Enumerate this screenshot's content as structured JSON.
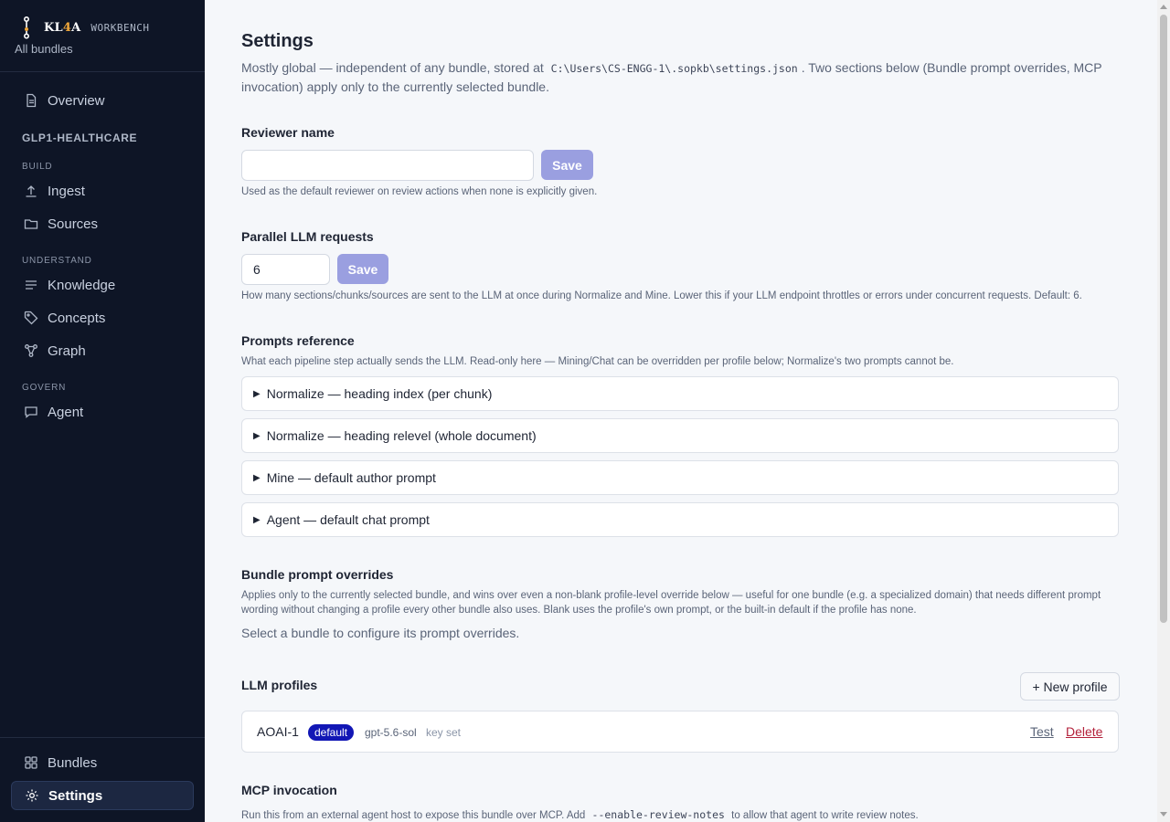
{
  "brand": {
    "name_prefix": "KL",
    "name_accent": "4",
    "name_suffix": "A",
    "subtitle": "WORKBENCH",
    "all_bundles": "All bundles"
  },
  "sidebar": {
    "overview": "Overview",
    "bundle_name": "GLP1-HEALTHCARE",
    "groups": {
      "build": "BUILD",
      "understand": "UNDERSTAND",
      "govern": "GOVERN"
    },
    "items": {
      "ingest": "Ingest",
      "sources": "Sources",
      "knowledge": "Knowledge",
      "concepts": "Concepts",
      "graph": "Graph",
      "agent": "Agent",
      "bundles": "Bundles",
      "settings": "Settings"
    },
    "active": "Settings"
  },
  "page": {
    "title": "Settings",
    "desc_before": "Mostly global — independent of any bundle, stored at",
    "desc_path": "C:\\Users\\CS-ENGG-1\\.sopkb\\settings.json",
    "desc_after": ". Two sections below (Bundle prompt overrides, MCP invocation) apply only to the currently selected bundle."
  },
  "reviewer": {
    "title": "Reviewer name",
    "value": "",
    "placeholder": "",
    "save_label": "Save",
    "help": "Used as the default reviewer on review actions when none is explicitly given."
  },
  "parallel": {
    "title": "Parallel LLM requests",
    "value": "6",
    "save_label": "Save",
    "help": "How many sections/chunks/sources are sent to the LLM at once during Normalize and Mine. Lower this if your LLM endpoint throttles or errors under concurrent requests. Default: 6."
  },
  "prompts": {
    "title": "Prompts reference",
    "help": "What each pipeline step actually sends the LLM. Read-only here — Mining/Chat can be overridden per profile below; Normalize's two prompts cannot be.",
    "items": [
      "Normalize — heading index (per chunk)",
      "Normalize — heading relevel (whole document)",
      "Mine — default author prompt",
      "Agent — default chat prompt"
    ]
  },
  "overrides": {
    "title": "Bundle prompt overrides",
    "help": "Applies only to the currently selected bundle, and wins over even a non-blank profile-level override below — useful for one bundle (e.g. a specialized domain) that needs different prompt wording without changing a profile every other bundle also uses. Blank uses the profile's own prompt, or the built-in default if the profile has none.",
    "empty": "Select a bundle to configure its prompt overrides."
  },
  "profiles": {
    "title": "LLM profiles",
    "new_label": "+ New profile",
    "list": [
      {
        "name": "AOAI-1",
        "badge": "default",
        "model": "gpt-5.6-sol",
        "key_status": "key set",
        "test_label": "Test",
        "delete_label": "Delete"
      }
    ]
  },
  "mcp": {
    "title": "MCP invocation",
    "help_before": "Run this from an external agent host to expose this bundle over MCP. Add",
    "flag": "--enable-review-notes",
    "help_after": "to allow that agent to write review notes."
  },
  "colors": {
    "sidebar_bg": "#0e1526",
    "accent_badge": "#1217b5",
    "save_button": "#9a9fe0",
    "delete_link": "#b3203a",
    "brand_accent": "#f2a93b"
  }
}
